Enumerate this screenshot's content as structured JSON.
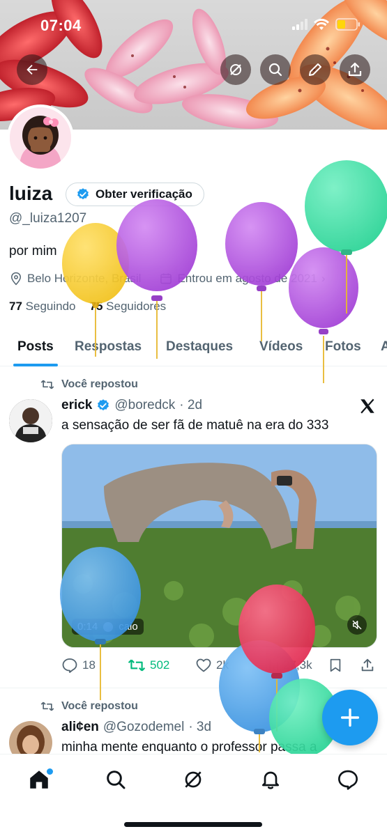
{
  "status": {
    "time": "07:04"
  },
  "profile": {
    "name": "luiza",
    "verify_label": "Obter verificação",
    "handle": "@_luiza1207",
    "bio": "por mim",
    "location": "Belo Horizonte, Brasil",
    "joined": "Entrou em agosto de 2021",
    "following_count": "77",
    "following_label": "Seguindo",
    "followers_count": "75",
    "followers_label": "Seguidores"
  },
  "tabs": [
    {
      "label": "Posts"
    },
    {
      "label": "Respostas"
    },
    {
      "label": "Destaques"
    },
    {
      "label": "Vídeos"
    },
    {
      "label": "Fotos"
    },
    {
      "label": "A"
    }
  ],
  "posts": [
    {
      "repost_label": "Você repostou",
      "author": "erick",
      "handle": "@boredck",
      "time": "· 2d",
      "text": "a sensação de ser fã de matuê na era do 333",
      "video_time": "0:14",
      "video_tag": "caio",
      "replies": "18",
      "reposts": "502",
      "likes": "2k",
      "views": "27,3k"
    },
    {
      "repost_label": "Você repostou",
      "author": "ali¢en",
      "handle": "@Gozodemel",
      "time": "· 3d",
      "text": "minha mente enquanto o professor passa a"
    }
  ],
  "fab": {
    "label": "+"
  },
  "colors": {
    "accent": "#1d9bf0",
    "repost_green": "#00ba7c",
    "text_secondary": "#536471"
  }
}
